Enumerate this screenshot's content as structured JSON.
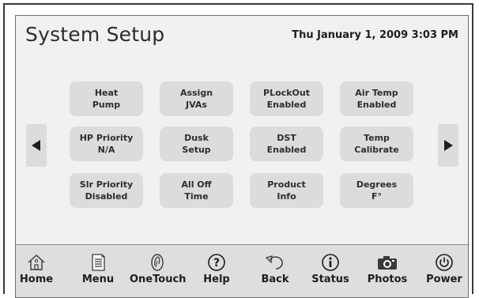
{
  "header": {
    "title": "System Setup",
    "datetime": "Thu January 1, 2009  3:03 PM"
  },
  "grid": {
    "row1": [
      {
        "line1": "Heat",
        "line2": "Pump"
      },
      {
        "line1": "Assign",
        "line2": "JVAs"
      },
      {
        "line1": "PLockOut",
        "line2": "Enabled"
      },
      {
        "line1": "Air Temp",
        "line2": "Enabled"
      }
    ],
    "row2": [
      {
        "line1": "HP Priority",
        "line2": "N/A"
      },
      {
        "line1": "Dusk",
        "line2": "Setup"
      },
      {
        "line1": "DST",
        "line2": "Enabled"
      },
      {
        "line1": "Temp",
        "line2": "Calibrate"
      }
    ],
    "row3": [
      {
        "line1": "Slr Priority",
        "line2": "Disabled"
      },
      {
        "line1": "All Off",
        "line2": "Time"
      },
      {
        "line1": "Product",
        "line2": "Info"
      },
      {
        "line1": "Degrees",
        "line2": "F°"
      }
    ]
  },
  "nav": {
    "prev_icon": "left-triangle-icon",
    "next_icon": "right-triangle-icon"
  },
  "toolbar": {
    "items": [
      {
        "label": "Home",
        "icon": "home-icon"
      },
      {
        "label": "Menu",
        "icon": "menu-icon"
      },
      {
        "label": "OneTouch",
        "icon": "onetouch-icon"
      },
      {
        "label": "Help",
        "icon": "help-icon"
      },
      {
        "label": "Back",
        "icon": "back-icon"
      },
      {
        "label": "Status",
        "icon": "status-icon"
      },
      {
        "label": "Photos",
        "icon": "camera-icon"
      },
      {
        "label": "Power",
        "icon": "power-icon"
      }
    ]
  },
  "colors": {
    "screen_bg": "#f1f1f1",
    "button_bg": "#dcdcdc",
    "toolbar_bg": "#dedede",
    "text": "#2d2d2d"
  }
}
